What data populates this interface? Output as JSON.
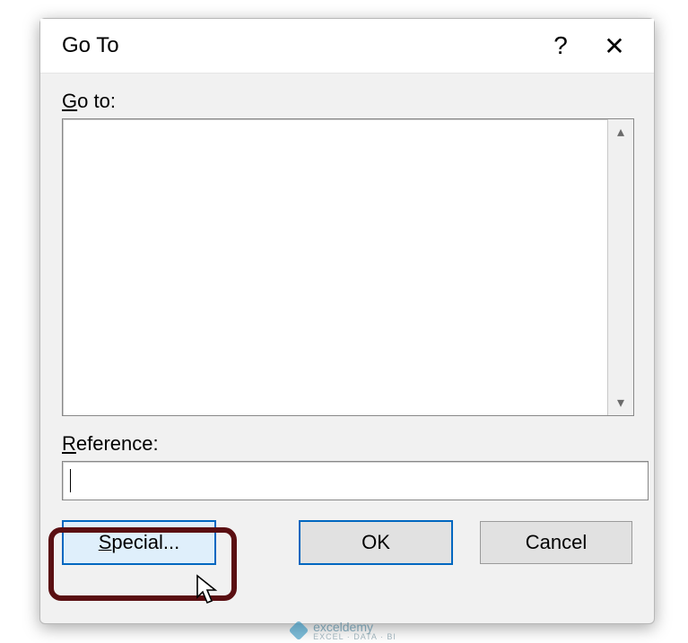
{
  "dialog": {
    "title": "Go To",
    "help_glyph": "?",
    "close_glyph": "✕",
    "goto_label": "Go to:",
    "reference_label": "Reference:",
    "reference_value": "",
    "scroll_up_glyph": "▴",
    "scroll_down_glyph": "▾",
    "buttons": {
      "special": "Special...",
      "ok": "OK",
      "cancel": "Cancel"
    }
  },
  "watermark": {
    "brand": "exceldemy",
    "tagline": "EXCEL · DATA · BI"
  }
}
